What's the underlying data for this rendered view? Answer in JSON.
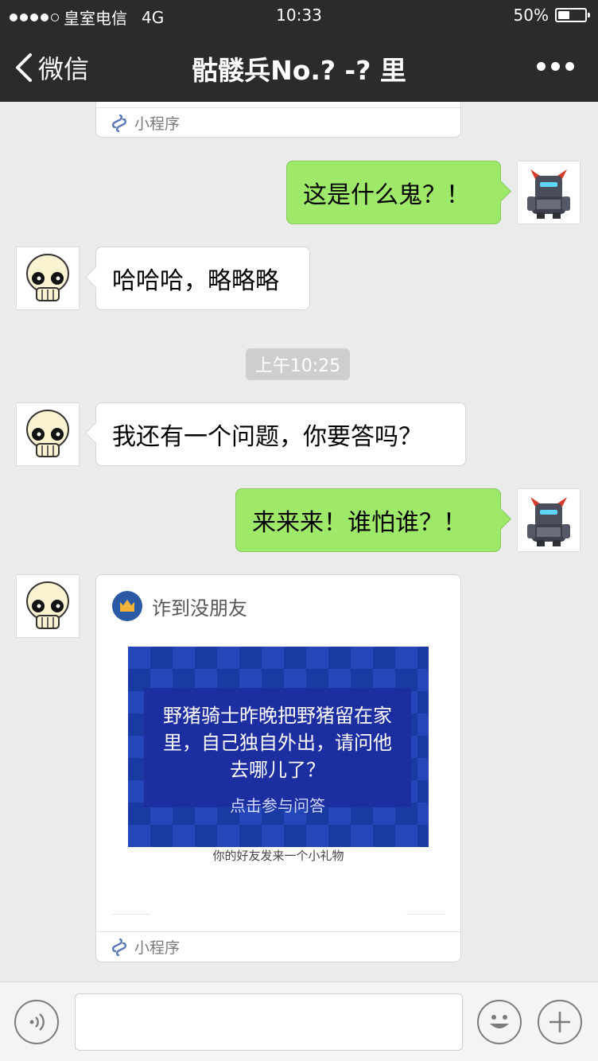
{
  "status_bar": {
    "carrier": "皇室电信",
    "network": "4G",
    "time": "10:33",
    "battery": "50%",
    "battery_level": 0.5
  },
  "nav": {
    "back_label": "微信",
    "title": "骷髅兵No.?  -?  里"
  },
  "messages": {
    "m1_footer": "小程序",
    "m2_text": "这是什么鬼？！",
    "m3_text": "哈哈哈，略略略",
    "timestamp": "上午10:25",
    "m4_text": "我还有一个问题，你要答吗？",
    "m5_text": "来来来！谁怕谁？！",
    "m6": {
      "app_name": "诈到没朋友",
      "question": "野猪骑士昨晚把野猪留在家里，自己独自外出，请问他去哪儿了？",
      "cta": "点击参与问答",
      "gift_text": "你的好友发来一个小礼物",
      "footer": "小程序"
    }
  },
  "colors": {
    "nav_bg": "#2b2b2d",
    "chat_bg": "#ebebeb",
    "out_bubble": "#9ee86a"
  }
}
